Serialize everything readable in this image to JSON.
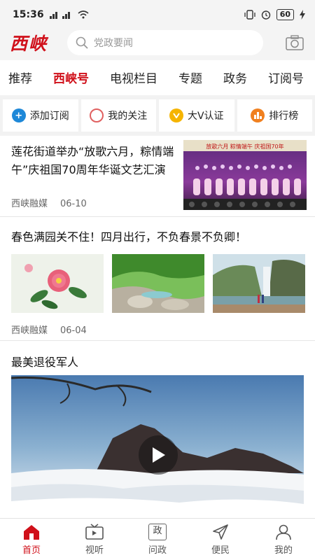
{
  "status_bar": {
    "time": "15:36",
    "signal": "📶",
    "battery": "60"
  },
  "header": {
    "logo": "西峡",
    "search_placeholder": "党政要闻"
  },
  "tabs": [
    {
      "label": "推荐"
    },
    {
      "label": "西峡号",
      "active": true
    },
    {
      "label": "电视栏目"
    },
    {
      "label": "专题"
    },
    {
      "label": "政务"
    },
    {
      "label": "订阅号"
    }
  ],
  "quick_actions": [
    {
      "label": "添加订阅",
      "icon": "plus-circle-icon",
      "color": "#1e88d8"
    },
    {
      "label": "我的关注",
      "icon": "circle-outline-icon",
      "color": "#e06060"
    },
    {
      "label": "大V认证",
      "icon": "v-badge-icon",
      "color": "#f5b400"
    },
    {
      "label": "排行榜",
      "icon": "bar-chart-icon",
      "color": "#f08020"
    }
  ],
  "articles": [
    {
      "title": "莲花街道举办“放歌六月，粽情端午”庆祖国70周年华诞文艺汇演",
      "source": "西峡融媒",
      "date": "06-10",
      "image_caption": "放歌六月 粽情端午 庆祖国70年"
    },
    {
      "title": "春色满园关不住！四月出行，不负春景不负卿！",
      "source": "西峡融媒",
      "date": "06-04"
    },
    {
      "title": "最美退役军人"
    }
  ],
  "bottom_nav": [
    {
      "label": "首页",
      "icon": "home-icon",
      "active": true
    },
    {
      "label": "视听",
      "icon": "tv-icon"
    },
    {
      "label": "问政",
      "icon": "zheng-icon",
      "glyph": "政"
    },
    {
      "label": "便民",
      "icon": "send-icon"
    },
    {
      "label": "我的",
      "icon": "user-icon"
    }
  ],
  "colors": {
    "brand": "#d0101a",
    "tab_active": "#d0101a"
  }
}
